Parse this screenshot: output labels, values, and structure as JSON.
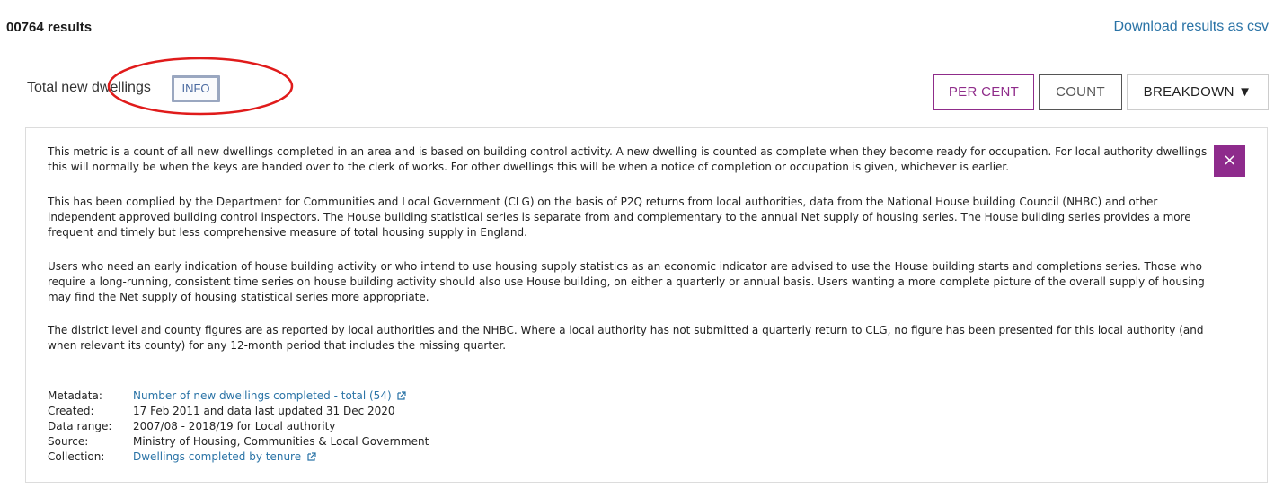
{
  "header": {
    "results_count": "00764 results",
    "download_label": "Download results as csv"
  },
  "metric": {
    "label": "Total new dwellings",
    "info_label": "INFO"
  },
  "view_buttons": {
    "per_cent": "PER CENT",
    "count": "COUNT",
    "breakdown": "BREAKDOWN ▼"
  },
  "info_panel": {
    "close_glyph": "×",
    "paragraphs": [
      "This metric is a count of all new dwellings completed in an area and is based on building control activity. A new dwelling is counted as complete when they become ready for occupation. For local authority dwellings this will normally be when the keys are handed over to the clerk of works. For other dwellings this will be when a notice of completion or occupation is given, whichever is earlier.",
      "This has been complied by the Department for Communities and Local Government (CLG) on the basis of P2Q returns from local authorities, data from the National House building Council (NHBC) and other independent approved building control inspectors. The House building statistical series is separate from and complementary to the annual Net supply of housing series. The House building series provides a more frequent and timely but less comprehensive measure of total housing supply in England.",
      "Users who need an early indication of house building activity or who intend to use housing supply statistics as an economic indicator are advised to use the House building starts and completions series. Those who require a long-running, consistent time series on house building activity should also use House building, on either a quarterly or annual basis. Users wanting a more complete picture of the overall supply of housing may find the Net supply of housing statistical series more appropriate.",
      "The district level and county figures are as reported by local authorities and the NHBC. Where a local authority has not submitted a quarterly return to CLG, no figure has been presented for this local authority (and when relevant its county) for any 12-month period that includes the missing quarter."
    ],
    "metadata": [
      {
        "key": "Metadata:",
        "value": "Number of new dwellings completed - total (54)",
        "is_link": true
      },
      {
        "key": "Created:",
        "value": "17 Feb 2011 and data last updated 31 Dec 2020",
        "is_link": false
      },
      {
        "key": "Data range:",
        "value": "2007/08 - 2018/19 for Local authority",
        "is_link": false
      },
      {
        "key": "Source:",
        "value": "Ministry of Housing, Communities & Local Government",
        "is_link": false
      },
      {
        "key": "Collection:",
        "value": "Dwellings completed by tenure",
        "is_link": true
      }
    ]
  },
  "icons": {
    "external_link": "external-link-icon",
    "close": "close-icon"
  },
  "colors": {
    "accent_purple": "#8e2b8c",
    "link_blue": "#2a73a6",
    "annotation_red": "#e01b1b"
  }
}
